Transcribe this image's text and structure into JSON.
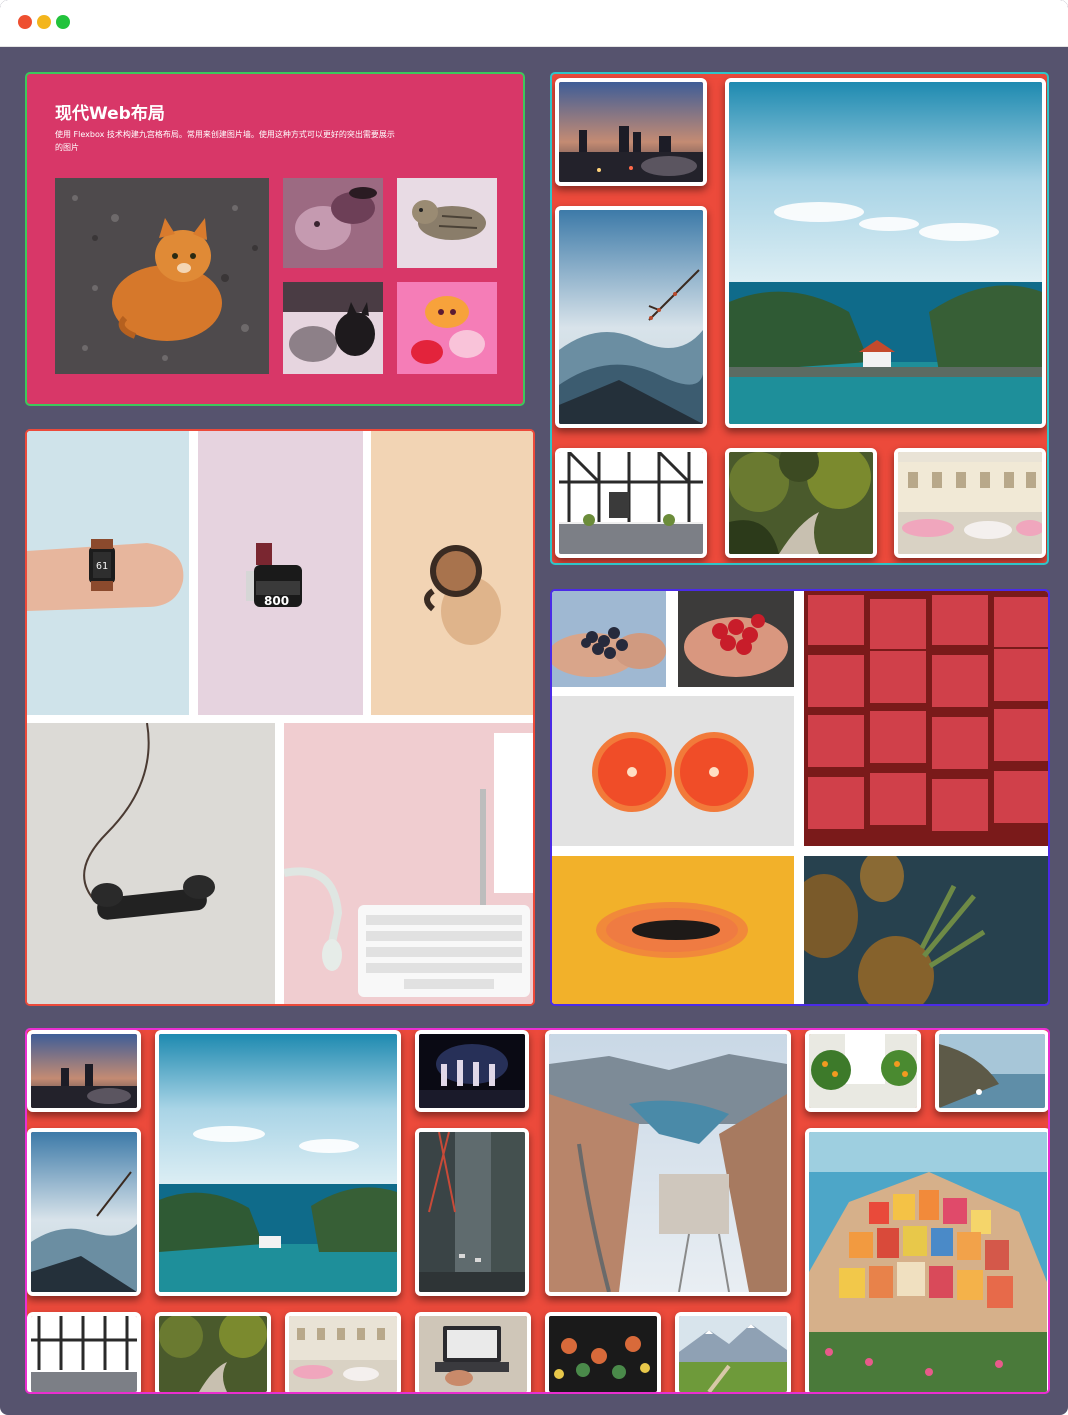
{
  "window": {
    "controls": [
      "close",
      "minimize",
      "maximize"
    ],
    "colors": {
      "background": "#56536e",
      "close": "#ee4f30",
      "minimize": "#f3b51c",
      "maximize": "#22c33c"
    }
  },
  "hero": {
    "title": "现代Web布局",
    "description": "使用 Flexbox 技术构建九宫格布局。常用来创建图片墙。使用这种方式可以更好的突出需要展示的图片",
    "accent": "#d83768",
    "images": [
      "orange-cat-photo",
      "cats-in-hands-photo",
      "tabby-cat-photo",
      "two-cats-photo",
      "kitten-pink-photo"
    ]
  },
  "panel_colors": {
    "hero_border": "#3cc85c",
    "gallery_border": "#2fc5c8",
    "objects_border": "#ec4a3b",
    "fruits_border": "#4b2be6",
    "wall_border": "#e92fd0",
    "red_bg": "#ec4a3b"
  },
  "gallery": {
    "images": [
      "city-sunset-photo",
      "misty-mountains-photo",
      "island-bay-photo",
      "tudor-house-photo",
      "forest-road-photo",
      "classic-cars-photo"
    ]
  },
  "objects": {
    "images": [
      "smartwatch-wrist-photo",
      "film-roll-photo",
      "coffee-cup-photo",
      "telephone-handset-photo",
      "headphones-keyboard-photo"
    ]
  },
  "fruits": {
    "images": [
      "blueberries-hands-photo",
      "strawberries-hands-photo",
      "grapefruit-halves-photo",
      "watermelon-cubes-photo",
      "papaya-photo",
      "pineapples-photo"
    ]
  },
  "wall": {
    "images": [
      "city-sunset-photo",
      "misty-mountains-photo",
      "island-bay-photo",
      "dancers-stage-photo",
      "city-street-photo",
      "canyon-dam-photo",
      "orange-trees-photo",
      "coast-cliff-photo",
      "colorful-village-photo",
      "tudor-house-photo",
      "forest-road-photo",
      "classic-cars-photo",
      "laptop-desk-photo",
      "ornaments-photo",
      "alpine-meadow-photo"
    ]
  }
}
